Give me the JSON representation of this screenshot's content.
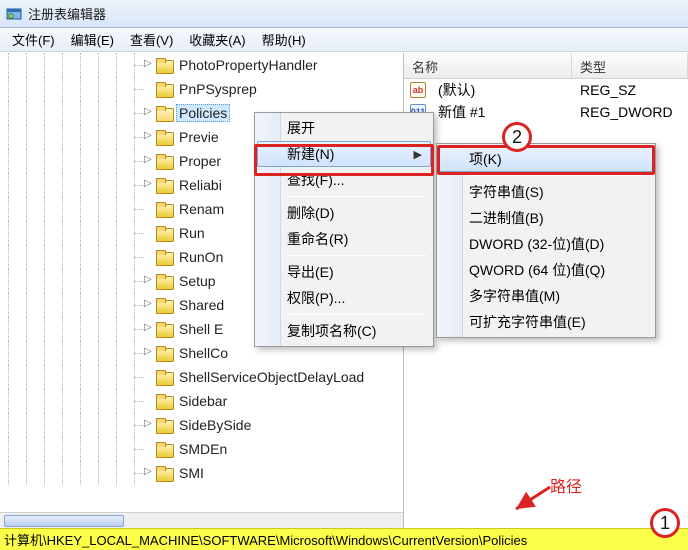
{
  "window": {
    "title": "注册表编辑器"
  },
  "menu": {
    "file": "文件(F)",
    "edit": "编辑(E)",
    "view": "查看(V)",
    "favorites": "收藏夹(A)",
    "help": "帮助(H)"
  },
  "tree": {
    "items": [
      {
        "label": "PhotoPropertyHandler",
        "expander": "▷"
      },
      {
        "label": "PnPSysprep",
        "expander": ""
      },
      {
        "label": "Policies",
        "expander": "▷",
        "selected": true,
        "open": true
      },
      {
        "label": "Previe",
        "expander": "▷"
      },
      {
        "label": "Proper",
        "expander": "▷"
      },
      {
        "label": "Reliabi",
        "expander": "▷"
      },
      {
        "label": "Renam",
        "expander": ""
      },
      {
        "label": "Run",
        "expander": ""
      },
      {
        "label": "RunOn",
        "expander": ""
      },
      {
        "label": "Setup",
        "expander": "▷"
      },
      {
        "label": "Shared",
        "expander": "▷"
      },
      {
        "label": "Shell E",
        "expander": "▷"
      },
      {
        "label": "ShellCo",
        "expander": "▷"
      },
      {
        "label": "ShellServiceObjectDelayLoad",
        "expander": ""
      },
      {
        "label": "Sidebar",
        "expander": ""
      },
      {
        "label": "SideBySide",
        "expander": "▷"
      },
      {
        "label": "SMDEn",
        "expander": ""
      },
      {
        "label": "SMI",
        "expander": "▷"
      }
    ]
  },
  "list": {
    "headers": {
      "name": "名称",
      "type": "类型"
    },
    "rows": [
      {
        "icon": "ab",
        "name": "(默认)",
        "type": "REG_SZ"
      },
      {
        "icon": "bin",
        "name": "新值 #1",
        "type": "REG_DWORD"
      }
    ]
  },
  "context_main": {
    "expand": "展开",
    "new": "新建(N)",
    "find": "查找(F)...",
    "delete": "删除(D)",
    "rename": "重命名(R)",
    "export": "导出(E)",
    "permissions": "权限(P)...",
    "copy_key_name": "复制项名称(C)"
  },
  "context_sub": {
    "key": "项(K)",
    "string": "字符串值(S)",
    "binary": "二进制值(B)",
    "dword": "DWORD (32-位)值(D)",
    "qword": "QWORD (64 位)值(Q)",
    "multi": "多字符串值(M)",
    "expand": "可扩充字符串值(E)"
  },
  "annotations": {
    "badge1": "1",
    "badge2": "2",
    "path_label": "路径"
  },
  "status": {
    "path": "计算机\\HKEY_LOCAL_MACHINE\\SOFTWARE\\Microsoft\\Windows\\CurrentVersion\\Policies"
  }
}
